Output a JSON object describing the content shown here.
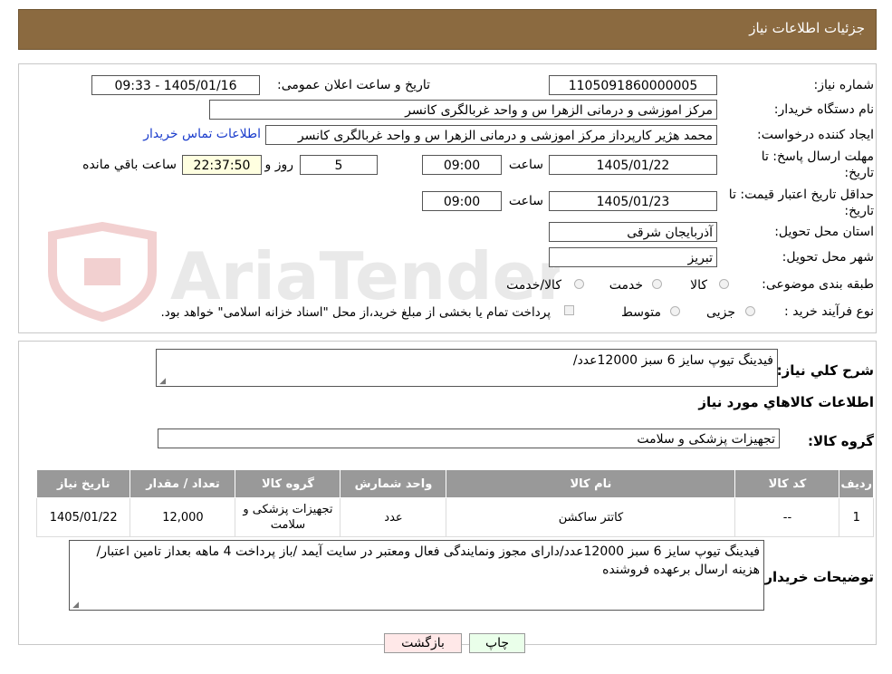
{
  "header": {
    "title": "جزئیات اطلاعات نیاز"
  },
  "fields": {
    "need_number_label": "شماره نیاز:",
    "need_number": "1105091860000005",
    "announce_label": "تاریخ و ساعت اعلان عمومی:",
    "announce_value": "1405/01/16 - 09:33",
    "buyer_label": "نام دستگاه خریدار:",
    "buyer_value": "مرکز اموزشی و درمانی الزهرا س  و واحد غربالگری کانسر",
    "creator_label": "ایجاد کننده درخواست:",
    "creator_value": "محمد هژیر کارپرداز مرکز اموزشی و درمانی الزهرا س  و واحد غربالگری کانسر",
    "contact_link": "اطلاعات تماس خریدار",
    "deadline_label": "مهلت ارسال پاسخ: تا تاریخ:",
    "deadline_date": "1405/01/22",
    "time_label": "ساعت",
    "deadline_time": "09:00",
    "days_value": "5",
    "days_label": "روز و",
    "remaining_value": "22:37:50",
    "remaining_label": "ساعت باقي مانده",
    "validity_label": "حداقل تاریخ اعتبار قیمت: تا تاریخ:",
    "validity_date": "1405/01/23",
    "validity_time": "09:00",
    "province_label": "استان محل تحویل:",
    "province_value": "آذربایجان شرقی",
    "city_label": "شهر محل تحویل:",
    "city_value": "تبریز",
    "category_label": "طبقه بندی موضوعی:",
    "category_options": [
      "کالا",
      "خدمت",
      "کالا/خدمت"
    ],
    "process_label": "نوع فرآیند خرید :",
    "process_options": [
      "جزیی",
      "متوسط"
    ],
    "treasury_note": "پرداخت تمام یا بخشی از مبلغ خرید،از محل \"اسناد خزانه اسلامی\" خواهد بود."
  },
  "description": {
    "label": "شرح كلي نياز:",
    "value": "فیدینگ تیوپ سایز 6 سبز 12000عدد/",
    "items_title": "اطلاعات كالاهاي مورد نياز",
    "group_label": "گروه کالا:",
    "group_value": "تجهیزات پزشکی و سلامت"
  },
  "table": {
    "headers": [
      "ردیف",
      "کد کالا",
      "نام کالا",
      "واحد شمارش",
      "گروه کالا",
      "تعداد / مقدار",
      "تاریخ نیاز"
    ],
    "rows": [
      [
        "1",
        "--",
        "کاتتر ساکشن",
        "عدد",
        "تجهیزات پزشکی و سلامت",
        "12,000",
        "1405/01/22"
      ]
    ]
  },
  "buyer_notes": {
    "label": "توضیحات خریدار:",
    "value": "فیدینگ تیوپ سایز 6 سبز 12000عدد/دارای مجوز ونمایندگی فعال ومعتبر در سایت آیمد /باز پرداخت 4 ماهه بعداز تامین اعتبار/هزینه ارسال برعهده فروشنده"
  },
  "buttons": {
    "print": "چاپ",
    "back": "بازگشت"
  },
  "watermark": {
    "text": "AriaTender.neT"
  },
  "colors": {
    "header_bg": "#8b6a40",
    "table_header_bg": "#999999",
    "link": "#1a3ccc",
    "remaining_bg": "#ffffe0"
  }
}
